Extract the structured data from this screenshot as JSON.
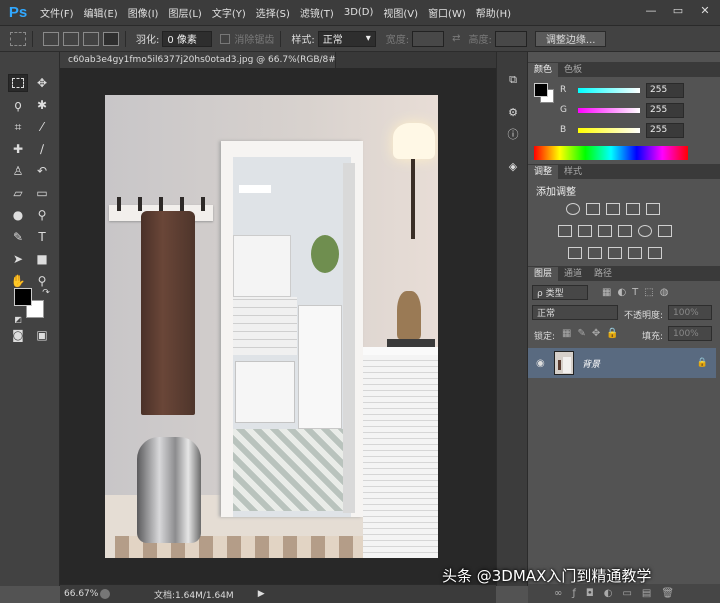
{
  "menubar": {
    "logo": "Ps",
    "items": [
      "文件(F)",
      "编辑(E)",
      "图像(I)",
      "图层(L)",
      "文字(Y)",
      "选择(S)",
      "滤镜(T)",
      "3D(D)",
      "视图(V)",
      "窗口(W)",
      "帮助(H)"
    ],
    "controls": [
      "—",
      "▭",
      "✕"
    ]
  },
  "options": {
    "feather_label": "羽化:",
    "feather_value": "0 像素",
    "antialias_label": "消除锯齿",
    "style_label": "样式:",
    "style_value": "正常",
    "width_label": "宽度:",
    "height_label": "高度:",
    "refine_button": "调整边缘..."
  },
  "document": {
    "tab_title": "c60ab3e4gy1fmo5il6377j20hs0otad3.jpg @ 66.7%(RGB/8#)",
    "close": "×",
    "zoom": "66.67%",
    "doc_info": "文档:1.64M/1.64M"
  },
  "color_panel": {
    "tabs": [
      "颜色",
      "色板"
    ],
    "channels": [
      {
        "letter": "R",
        "value": "255"
      },
      {
        "letter": "G",
        "value": "255"
      },
      {
        "letter": "B",
        "value": "255"
      }
    ]
  },
  "adjust_panel": {
    "tabs": [
      "调整",
      "样式"
    ],
    "title": "添加调整"
  },
  "layers_panel": {
    "tabs": [
      "图层",
      "通道",
      "路径"
    ],
    "kind_label": "ρ 类型",
    "blend_mode": "正常",
    "opacity_label": "不透明度:",
    "opacity_value": "100%",
    "lock_label": "锁定:",
    "fill_label": "填充:",
    "fill_value": "100%",
    "layer_name": "背景"
  },
  "watermark": "头条 @3DMAX入门到精通教学"
}
